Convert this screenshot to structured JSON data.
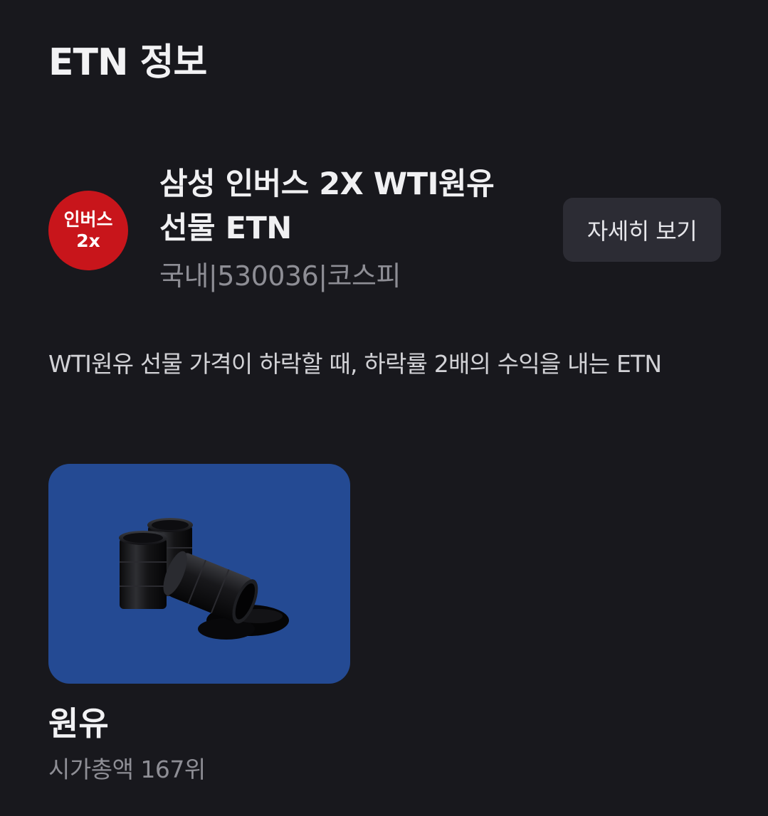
{
  "section": {
    "title": "ETN 정보"
  },
  "product": {
    "badge_line1": "인버스",
    "badge_line2": "2x",
    "badge_color": "#c8151b",
    "name_line1": "삼성 인버스 2X WTI원유",
    "name_line2": "선물 ETN",
    "meta": "국내|530036|코스피",
    "detail_button_label": "자세히 보기"
  },
  "description": "WTI원유 선물 가격이 하락할 때, 하락률 2배의 수익을 내는 ETN",
  "category": {
    "image_icon": "oil-barrels-icon",
    "card_color": "#244a93",
    "title": "원유",
    "rank": "시가총액 167위"
  }
}
